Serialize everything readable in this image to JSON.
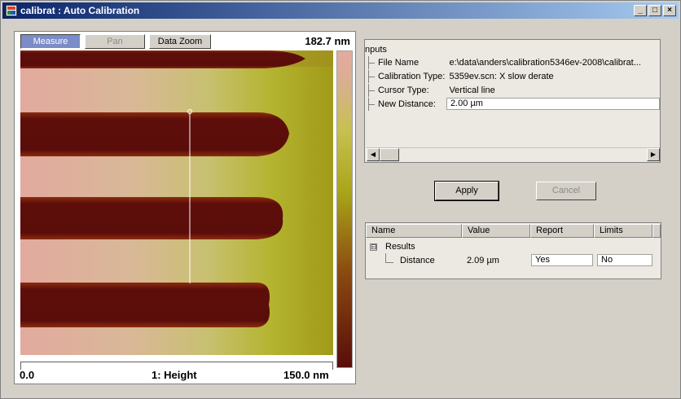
{
  "window": {
    "title": "calibrat : Auto Calibration",
    "controls": {
      "minimize": "_",
      "maximize": "□",
      "close": "×"
    }
  },
  "view": {
    "buttons": {
      "measure": "Measure",
      "pan": "Pan",
      "data_zoom": "Data Zoom"
    },
    "z_max": "182.7 nm",
    "axis_min": "0.0",
    "channel": "1: Height",
    "axis_max": "150.0 nm",
    "colors": {
      "bar": "#5a0d0a",
      "bar_edge": "#8a2a10",
      "background_left": "#e2aa9e",
      "background_right": "#a8a418",
      "cursor": "#ffffff"
    }
  },
  "inputs": {
    "title": "nputs",
    "rows": [
      {
        "name": "File Name",
        "value": "e:\\data\\anders\\calibration5346ev-2008\\calibrat..."
      },
      {
        "name": "Calibration Type:",
        "value": "5359ev.scn: X slow derate"
      },
      {
        "name": "Cursor Type:",
        "value": "Vertical line"
      },
      {
        "name": "New Distance:",
        "value": "2.00 µm"
      }
    ]
  },
  "actions": {
    "apply": "Apply",
    "cancel": "Cancel"
  },
  "results": {
    "headers": [
      "Name",
      "Value",
      "Report",
      "Limits"
    ],
    "group": {
      "expander": "⊟",
      "label": "Results"
    },
    "rows": [
      {
        "name": "Distance",
        "value": "2.09 µm",
        "report": "Yes",
        "limits": "No"
      }
    ]
  },
  "scroll": {
    "left": "◀",
    "right": "▶"
  }
}
